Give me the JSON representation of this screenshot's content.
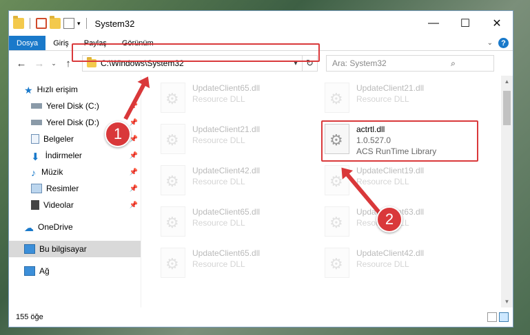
{
  "window": {
    "title": "System32",
    "minimize_icon": "minimize-icon",
    "maximize_icon": "maximize-icon",
    "close_icon": "close-icon"
  },
  "ribbon": {
    "tabs": [
      "Dosya",
      "Giriş",
      "Paylaş",
      "Görünüm"
    ],
    "accent": "#1979ca"
  },
  "navigation": {
    "address": "C:\\Windows\\System32",
    "search_placeholder": "Ara: System32"
  },
  "sidebar": {
    "items": [
      {
        "label": "Hızlı erişim",
        "icon": "star-icon"
      },
      {
        "label": "Yerel Disk (C:)",
        "icon": "drive-icon",
        "pinned": true
      },
      {
        "label": "Yerel Disk (D:)",
        "icon": "drive-icon",
        "pinned": true
      },
      {
        "label": "Belgeler",
        "icon": "documents-icon",
        "pinned": true
      },
      {
        "label": "İndirmeler",
        "icon": "download-icon",
        "pinned": true
      },
      {
        "label": "Müzik",
        "icon": "music-icon",
        "pinned": true
      },
      {
        "label": "Resimler",
        "icon": "pictures-icon",
        "pinned": true
      },
      {
        "label": "Videolar",
        "icon": "video-icon",
        "pinned": true
      },
      {
        "label": "OneDrive",
        "icon": "cloud-icon"
      },
      {
        "label": "Bu bilgisayar",
        "icon": "computer-icon",
        "selected": true
      },
      {
        "label": "Ağ",
        "icon": "network-icon"
      }
    ]
  },
  "files": [
    {
      "name": "UpdateClient65.dll",
      "desc": "Resource DLL"
    },
    {
      "name": "UpdateClient21.dll",
      "desc": "Resource DLL"
    },
    {
      "name": "UpdateClient21.dll",
      "desc": "Resource DLL"
    },
    {
      "name": "actrtl.dll",
      "version": "1.0.527.0",
      "desc": "ACS RunTime Library",
      "highlighted": true
    },
    {
      "name": "UpdateClient42.dll",
      "desc": "Resource DLL"
    },
    {
      "name": "UpdateClient19.dll",
      "desc": "Resource DLL"
    },
    {
      "name": "UpdateClient65.dll",
      "desc": "Resource DLL"
    },
    {
      "name": "UpdateClient63.dll",
      "desc": "Resource DLL"
    },
    {
      "name": "UpdateClient65.dll",
      "desc": "Resource DLL"
    },
    {
      "name": "UpdateClient42.dll",
      "desc": "Resource DLL"
    }
  ],
  "status": {
    "count": "155 öğe"
  },
  "callouts": [
    "1",
    "2"
  ],
  "highlight_color": "#d9383a"
}
